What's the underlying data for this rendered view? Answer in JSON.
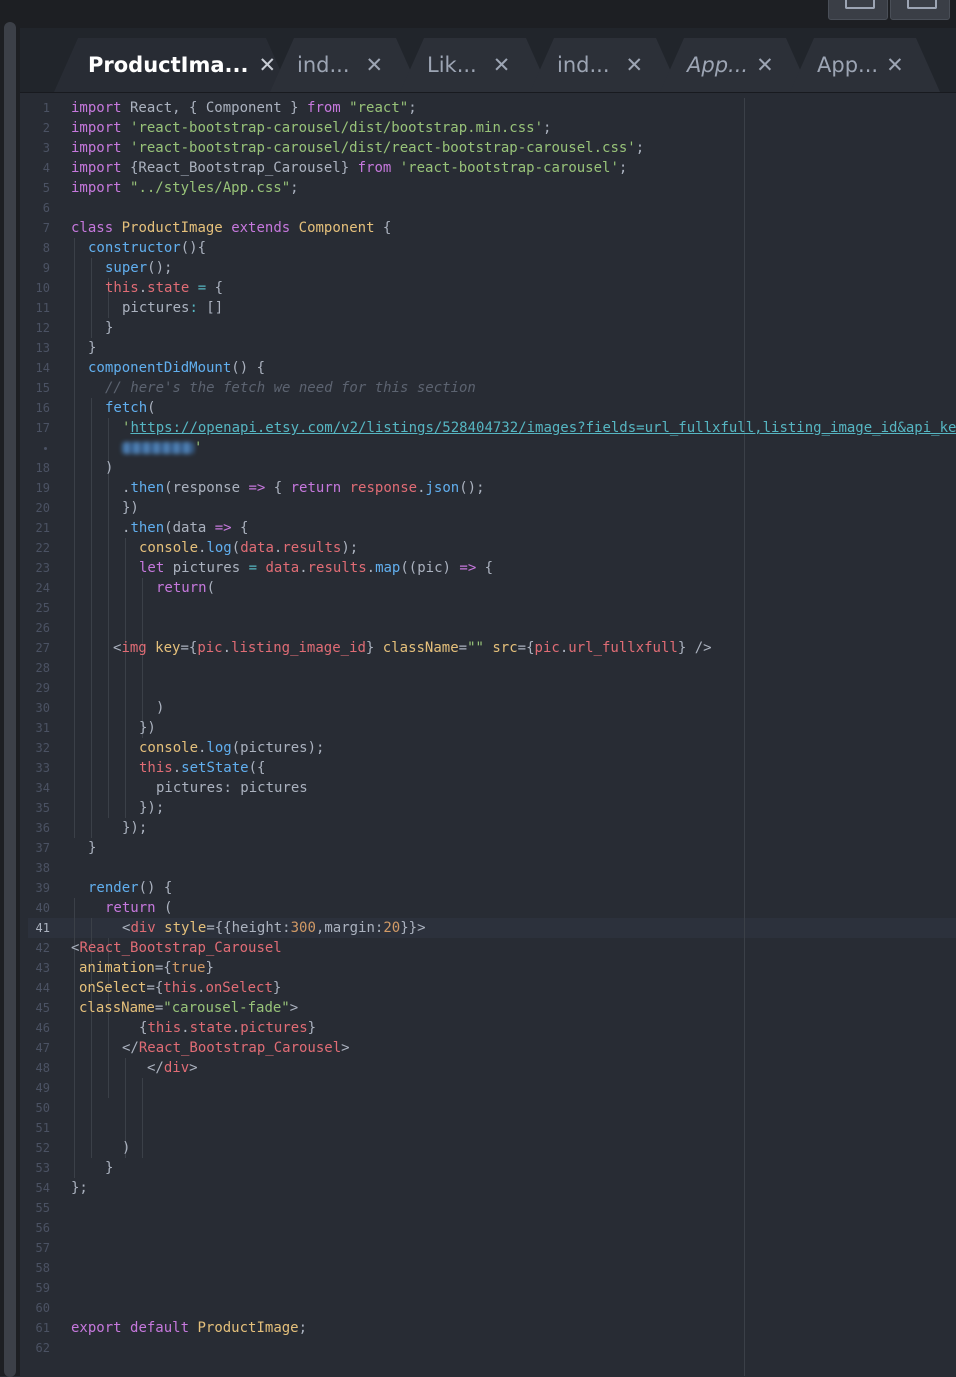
{
  "tabs": [
    {
      "label": "ProductIma...",
      "active": true,
      "italic": false
    },
    {
      "label": "ind...",
      "active": false,
      "italic": false
    },
    {
      "label": "Lik...",
      "active": false,
      "italic": false
    },
    {
      "label": "ind...",
      "active": false,
      "italic": false
    },
    {
      "label": "App...",
      "active": false,
      "italic": true
    },
    {
      "label": "App...",
      "active": false,
      "italic": false
    }
  ],
  "close_glyph": "✕",
  "current_line": 41,
  "colors": {
    "background": "#282c34",
    "keyword": "#c678dd",
    "string": "#98c379",
    "function": "#61afef",
    "class": "#e5c07b",
    "variable": "#e06c75",
    "number": "#d19a66"
  },
  "code": {
    "l1": {
      "a": "import",
      "b": " React, { Component } ",
      "c": "from",
      "d": " ",
      "e": "\"react\"",
      "f": ";"
    },
    "l2": {
      "a": "import",
      "b": " ",
      "c": "'react-bootstrap-carousel/dist/bootstrap.min.css'",
      "d": ";"
    },
    "l3": {
      "a": "import",
      "b": " ",
      "c": "'react-bootstrap-carousel/dist/react-bootstrap-carousel.css'",
      "d": ";"
    },
    "l4": {
      "a": "import",
      "b": " {React_Bootstrap_Carousel} ",
      "c": "from",
      "d": " ",
      "e": "'react-bootstrap-carousel'",
      "f": ";"
    },
    "l5": {
      "a": "import",
      "b": " ",
      "c": "\"../styles/App.css\"",
      "d": ";"
    },
    "l7": {
      "a": "class",
      "b": " ",
      "c": "ProductImage",
      "d": " ",
      "e": "extends",
      "f": " ",
      "g": "Component",
      "h": " {"
    },
    "l8": {
      "a": "constructor",
      "b": "(){"
    },
    "l9": {
      "a": "super",
      "b": "();"
    },
    "l10": {
      "a": "this",
      "b": ".",
      "c": "state",
      "d": " ",
      "e": "=",
      "f": " {"
    },
    "l11": {
      "a": "pictures",
      "b": ": ",
      "c": "[]"
    },
    "l12": {
      "a": "}"
    },
    "l13": {
      "a": "}"
    },
    "l14": {
      "a": "componentDidMount",
      "b": "() {"
    },
    "l15": {
      "a": "// here's the fetch we need for this section"
    },
    "l16": {
      "a": "fetch",
      "b": "("
    },
    "l17": {
      "a": "'",
      "b": "https://openapi.etsy.com/v2/listings/528404732/images?fields=url_fullxfull,listing_image_id&api_ke"
    },
    "l17w": {
      "a": "'"
    },
    "l18": {
      "a": ")"
    },
    "l19": {
      "a": ".",
      "b": "then",
      "c": "(response ",
      "d": "=>",
      "e": " { ",
      "f": "return",
      "g": " ",
      "h": "response",
      "i": ".",
      "j": "json",
      "k": "();"
    },
    "l20": {
      "a": "})"
    },
    "l21": {
      "a": ".",
      "b": "then",
      "c": "(data ",
      "d": "=>",
      "e": " {"
    },
    "l22": {
      "a": "console",
      "b": ".",
      "c": "log",
      "d": "(",
      "e": "data",
      "f": ".",
      "g": "results",
      "h": ");"
    },
    "l23": {
      "a": "let",
      "b": " pictures ",
      "c": "=",
      "d": " ",
      "e": "data",
      "f": ".",
      "g": "results",
      "h": ".",
      "i": "map",
      "j": "((pic) ",
      "k": "=>",
      "l": " {"
    },
    "l24": {
      "a": "return",
      "b": "("
    },
    "l27": {
      "a": "<",
      "b": "img",
      "c": " ",
      "d": "key",
      "e": "={",
      "f": "pic",
      "g": ".",
      "h": "listing_image_id",
      "i": "} ",
      "j": "className",
      "k": "=",
      "l": "\"\"",
      "m": " ",
      "n": "src",
      "o": "={",
      "p": "pic",
      "q": ".",
      "r": "url_fullxfull",
      "s": "} />"
    },
    "l30": {
      "a": ")"
    },
    "l31": {
      "a": "})"
    },
    "l32": {
      "a": "console",
      "b": ".",
      "c": "log",
      "d": "(pictures);"
    },
    "l33": {
      "a": "this",
      "b": ".",
      "c": "setState",
      "d": "({"
    },
    "l34": {
      "a": "pictures",
      "b": ": pictures"
    },
    "l35": {
      "a": "});"
    },
    "l36": {
      "a": "});"
    },
    "l37": {
      "a": "}"
    },
    "l39": {
      "a": "render",
      "b": "() {"
    },
    "l40": {
      "a": "return",
      "b": " ("
    },
    "l41": {
      "a": "<",
      "b": "div",
      "c": " ",
      "d": "style",
      "e": "={{height:",
      "f": "300",
      "g": ",margin:",
      "h": "20",
      "i": "}}>"
    },
    "l42": {
      "a": "<",
      "b": "React_Bootstrap_Carousel"
    },
    "l43": {
      "a": "animation",
      "b": "={",
      "c": "true",
      "d": "}"
    },
    "l44": {
      "a": "onSelect",
      "b": "={",
      "c": "this",
      "d": ".",
      "e": "onSelect",
      "f": "}"
    },
    "l45": {
      "a": "className",
      "b": "=",
      "c": "\"carousel-fade\"",
      "d": ">"
    },
    "l46": {
      "a": "{",
      "b": "this",
      "c": ".",
      "d": "state",
      "e": ".",
      "f": "pictures",
      "g": "}"
    },
    "l47": {
      "a": "</",
      "b": "React_Bootstrap_Carousel",
      "c": ">"
    },
    "l48": {
      "a": "</",
      "b": "div",
      "c": ">"
    },
    "l52": {
      "a": ")"
    },
    "l53": {
      "a": "}"
    },
    "l54": {
      "a": "};"
    },
    "l61": {
      "a": "export",
      "b": " ",
      "c": "default",
      "d": " ",
      "e": "ProductImage",
      "f": ";"
    }
  }
}
